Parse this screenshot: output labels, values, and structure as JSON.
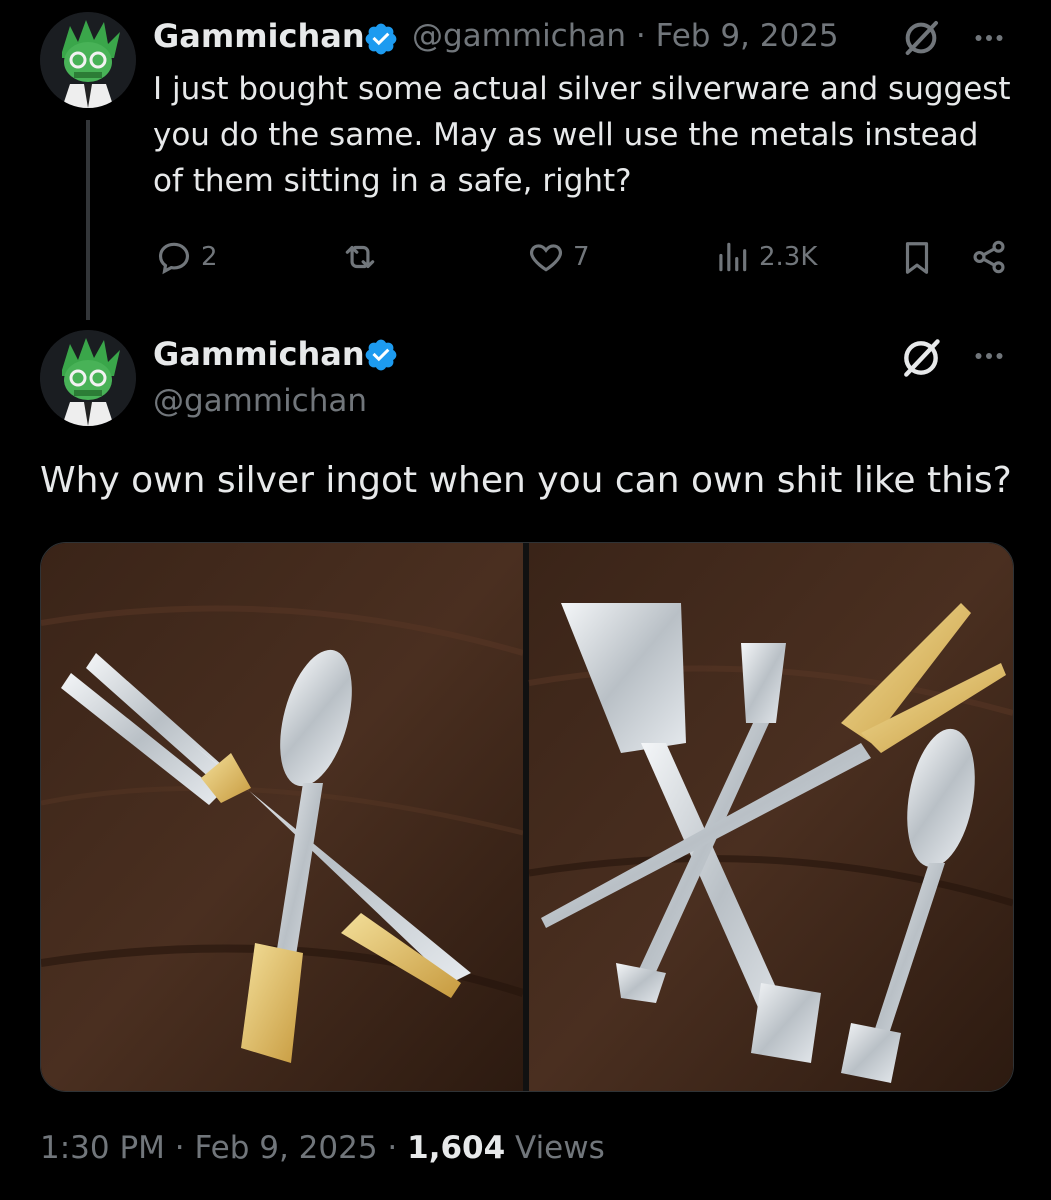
{
  "colors": {
    "background": "#000000",
    "text_primary": "#e7e9ea",
    "text_secondary": "#71767b",
    "verified_blue": "#1d9bf0",
    "thread_line": "#333639"
  },
  "reply_tweet": {
    "author_name": "Gammichan",
    "meta": "@gammichan · Feb 9, 2025",
    "text_lines": [
      "I just bought some actual silver silverware and suggest",
      "you do the same. May as well use the metals instead",
      "of them sitting in a safe, right?"
    ],
    "actions": {
      "replies": "2",
      "reposts": "",
      "likes": "7",
      "views": "2.3K"
    }
  },
  "main_tweet": {
    "author_name": "Gammichan",
    "handle": "@gammichan",
    "text": "Why own silver ingot when you can own shit like this?",
    "media_left_icon": "fork-and-spoon-photo",
    "media_right_icon": "serving-utensils-photo",
    "footer": {
      "time": "1:30 PM",
      "separator": " · ",
      "date": "Feb 9, 2025",
      "separator2": " · ",
      "views_count": "1,604",
      "views_label": " Views"
    }
  }
}
